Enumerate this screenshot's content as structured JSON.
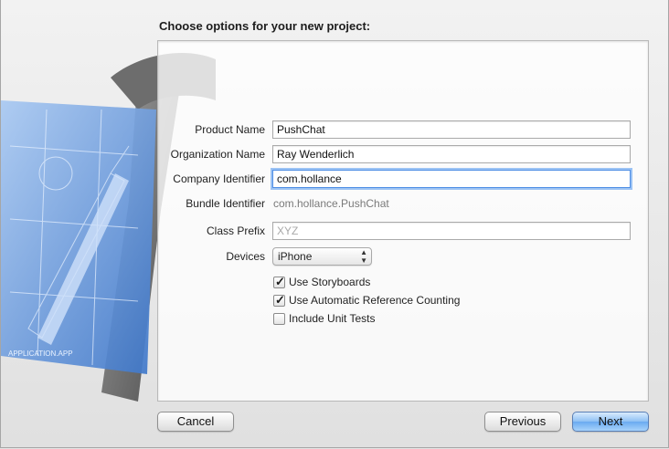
{
  "dialog": {
    "title": "Choose options for your new project:"
  },
  "art": {
    "icon": "xcode-hammer-blueprint-icon",
    "caption": "APPLICATION.APP"
  },
  "form": {
    "product_name": {
      "label": "Product Name",
      "value": "PushChat"
    },
    "organization_name": {
      "label": "Organization Name",
      "value": "Ray Wenderlich"
    },
    "company_identifier": {
      "label": "Company Identifier",
      "value": "com.hollance"
    },
    "bundle_identifier": {
      "label": "Bundle Identifier",
      "value": "com.hollance.PushChat"
    },
    "class_prefix": {
      "label": "Class Prefix",
      "placeholder": "XYZ"
    },
    "devices": {
      "label": "Devices",
      "selected": "iPhone"
    },
    "checkboxes": [
      {
        "label": "Use Storyboards",
        "checked": true
      },
      {
        "label": "Use Automatic Reference Counting",
        "checked": true
      },
      {
        "label": "Include Unit Tests",
        "checked": false
      }
    ]
  },
  "buttons": {
    "cancel": "Cancel",
    "previous": "Previous",
    "next": "Next"
  },
  "colors": {
    "accent": "#6aaaf0",
    "blueprint": "#5b8fd6"
  }
}
